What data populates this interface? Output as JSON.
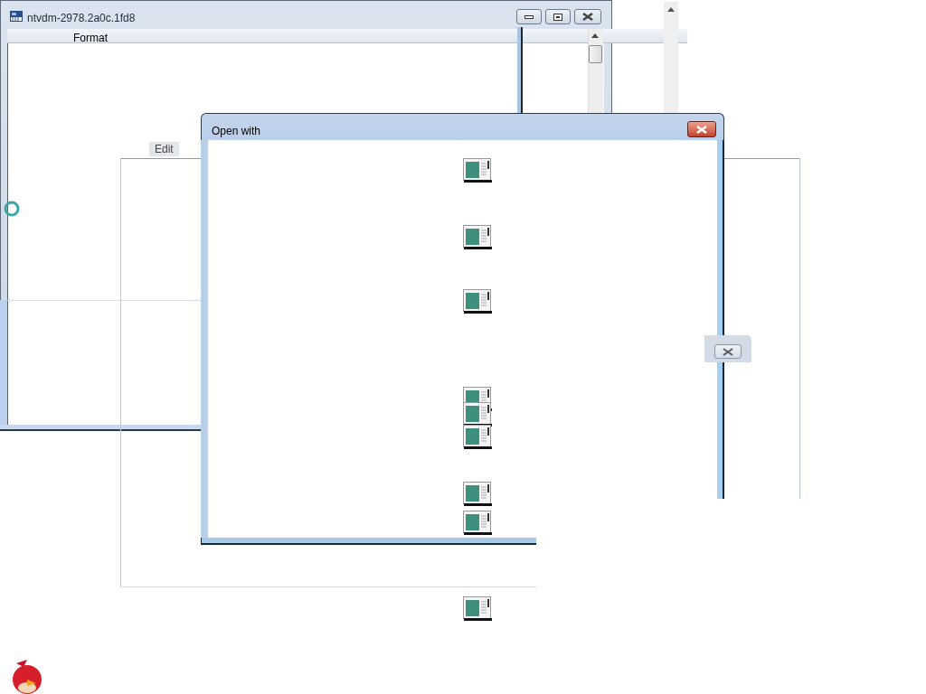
{
  "main_window": {
    "title": "ntvdm-2978.2a0c.1fd8",
    "menu_items": [
      "Format",
      "Edit"
    ]
  },
  "dialog": {
    "title": "Open with"
  }
}
